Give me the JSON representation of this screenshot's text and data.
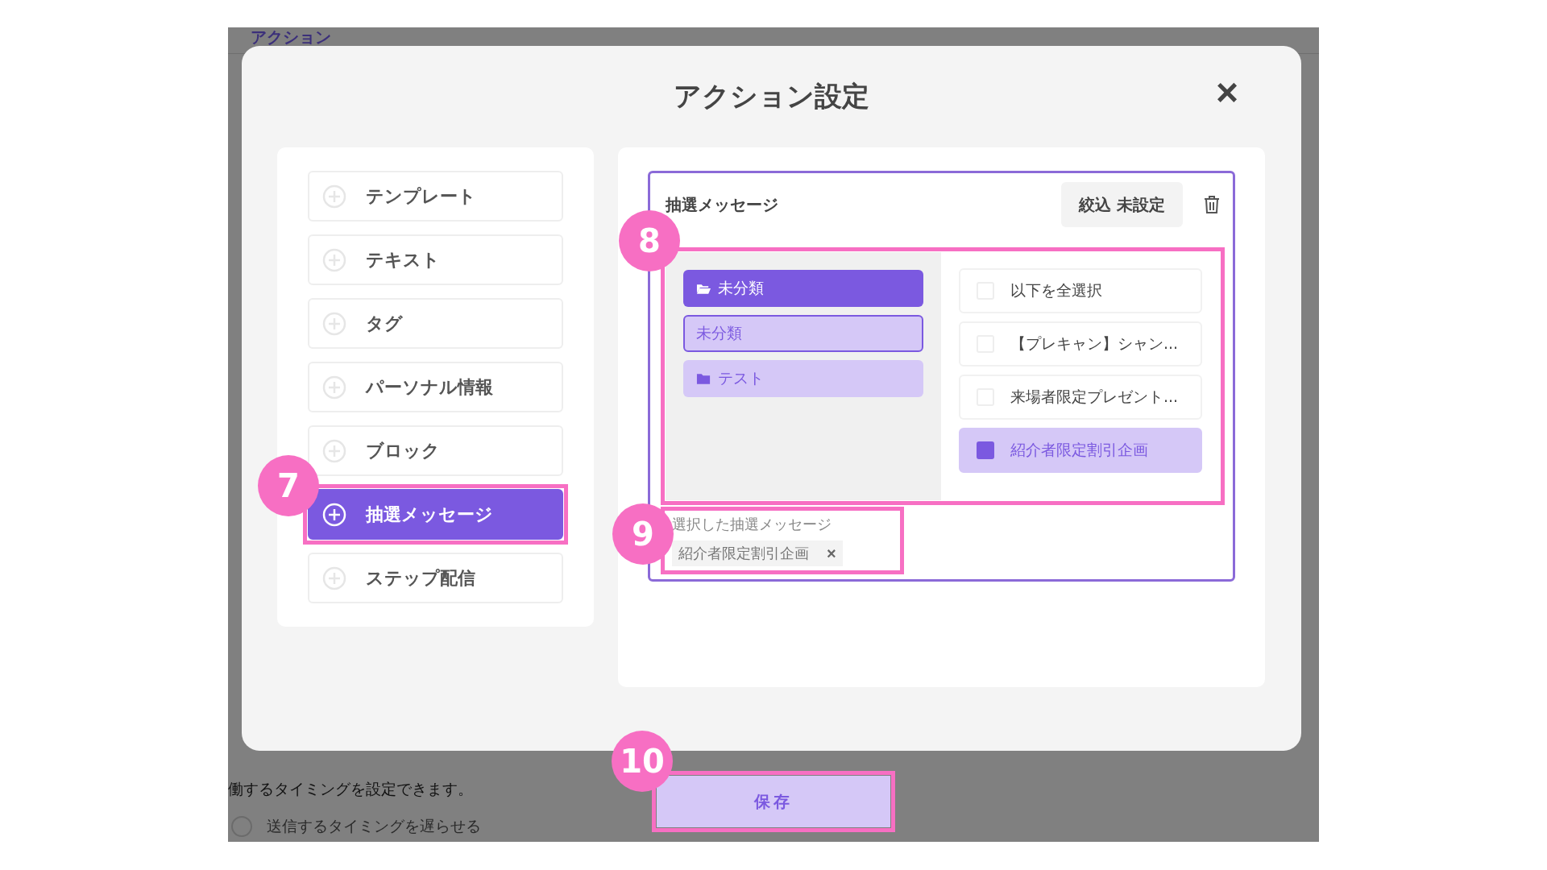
{
  "background": {
    "header": "アクション",
    "description": "働するタイミングを設定できます。",
    "radio": {
      "label": "送信するタイミングを遅らせる",
      "selected": false
    }
  },
  "dialog": {
    "title": "アクション設定",
    "close": "×"
  },
  "sidebar": {
    "items": [
      {
        "label": "テンプレート",
        "selected": false
      },
      {
        "label": "テキスト",
        "selected": false
      },
      {
        "label": "タグ",
        "selected": false
      },
      {
        "label": "パーソナル情報",
        "selected": false
      },
      {
        "label": "ブロック",
        "selected": false
      },
      {
        "label": "抽選メッセージ",
        "selected": true,
        "callout": "7"
      },
      {
        "label": "ステップ配信",
        "selected": false
      }
    ]
  },
  "action": {
    "title": "抽選メッセージ",
    "filter_button": "絞込 未設定",
    "picker": {
      "callout": "8",
      "folders": [
        {
          "kind": "folder",
          "label": "未分類",
          "selected": true,
          "focused": false
        },
        {
          "kind": "item",
          "label": "未分類",
          "selected": false,
          "focused": true
        },
        {
          "kind": "folder",
          "label": "テスト",
          "selected": false,
          "focused": false
        }
      ],
      "messages": [
        {
          "label": "以下を全選択",
          "checked": false
        },
        {
          "label": "【プレキャン】シャン...",
          "checked": false
        },
        {
          "label": "来場者限定プレゼント...",
          "checked": false
        },
        {
          "label": "紹介者限定割引企画",
          "checked": true
        }
      ]
    },
    "selected": {
      "callout": "9",
      "label": "選択した抽選メッセージ",
      "chips": [
        {
          "label": "紹介者限定割引企画",
          "remove": "×"
        }
      ]
    }
  },
  "save_button": {
    "label": "保存",
    "callout": "10"
  }
}
